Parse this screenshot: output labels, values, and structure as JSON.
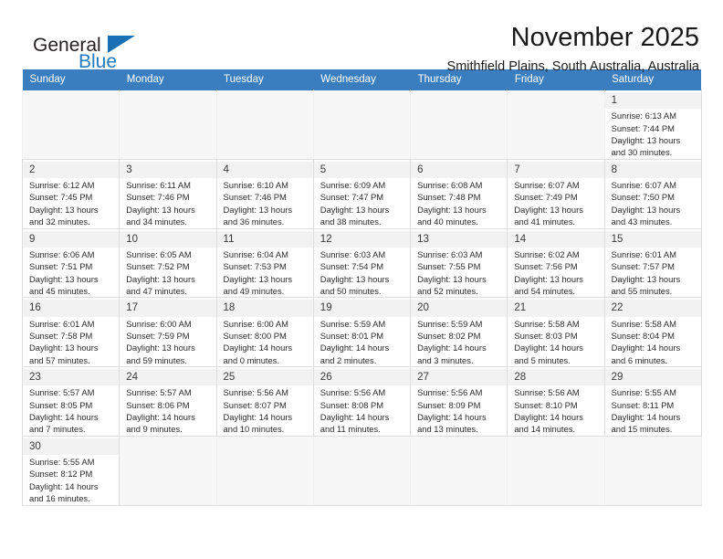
{
  "brand": {
    "name_top": "General",
    "name_bottom": "Blue",
    "accent_color": "#1a6fb5"
  },
  "header": {
    "title": "November 2025",
    "subtitle": "Smithfield Plains, South Australia, Australia"
  },
  "calendar": {
    "header_bg": "#3a7ebf",
    "weekdays": [
      "Sunday",
      "Monday",
      "Tuesday",
      "Wednesday",
      "Thursday",
      "Friday",
      "Saturday"
    ],
    "weeks": [
      [
        {
          "day": "",
          "detail": ""
        },
        {
          "day": "",
          "detail": ""
        },
        {
          "day": "",
          "detail": ""
        },
        {
          "day": "",
          "detail": ""
        },
        {
          "day": "",
          "detail": ""
        },
        {
          "day": "",
          "detail": ""
        },
        {
          "day": "1",
          "detail": "Sunrise: 6:13 AM\nSunset: 7:44 PM\nDaylight: 13 hours and 30 minutes."
        }
      ],
      [
        {
          "day": "2",
          "detail": "Sunrise: 6:12 AM\nSunset: 7:45 PM\nDaylight: 13 hours and 32 minutes."
        },
        {
          "day": "3",
          "detail": "Sunrise: 6:11 AM\nSunset: 7:46 PM\nDaylight: 13 hours and 34 minutes."
        },
        {
          "day": "4",
          "detail": "Sunrise: 6:10 AM\nSunset: 7:46 PM\nDaylight: 13 hours and 36 minutes."
        },
        {
          "day": "5",
          "detail": "Sunrise: 6:09 AM\nSunset: 7:47 PM\nDaylight: 13 hours and 38 minutes."
        },
        {
          "day": "6",
          "detail": "Sunrise: 6:08 AM\nSunset: 7:48 PM\nDaylight: 13 hours and 40 minutes."
        },
        {
          "day": "7",
          "detail": "Sunrise: 6:07 AM\nSunset: 7:49 PM\nDaylight: 13 hours and 41 minutes."
        },
        {
          "day": "8",
          "detail": "Sunrise: 6:07 AM\nSunset: 7:50 PM\nDaylight: 13 hours and 43 minutes."
        }
      ],
      [
        {
          "day": "9",
          "detail": "Sunrise: 6:06 AM\nSunset: 7:51 PM\nDaylight: 13 hours and 45 minutes."
        },
        {
          "day": "10",
          "detail": "Sunrise: 6:05 AM\nSunset: 7:52 PM\nDaylight: 13 hours and 47 minutes."
        },
        {
          "day": "11",
          "detail": "Sunrise: 6:04 AM\nSunset: 7:53 PM\nDaylight: 13 hours and 49 minutes."
        },
        {
          "day": "12",
          "detail": "Sunrise: 6:03 AM\nSunset: 7:54 PM\nDaylight: 13 hours and 50 minutes."
        },
        {
          "day": "13",
          "detail": "Sunrise: 6:03 AM\nSunset: 7:55 PM\nDaylight: 13 hours and 52 minutes."
        },
        {
          "day": "14",
          "detail": "Sunrise: 6:02 AM\nSunset: 7:56 PM\nDaylight: 13 hours and 54 minutes."
        },
        {
          "day": "15",
          "detail": "Sunrise: 6:01 AM\nSunset: 7:57 PM\nDaylight: 13 hours and 55 minutes."
        }
      ],
      [
        {
          "day": "16",
          "detail": "Sunrise: 6:01 AM\nSunset: 7:58 PM\nDaylight: 13 hours and 57 minutes."
        },
        {
          "day": "17",
          "detail": "Sunrise: 6:00 AM\nSunset: 7:59 PM\nDaylight: 13 hours and 59 minutes."
        },
        {
          "day": "18",
          "detail": "Sunrise: 6:00 AM\nSunset: 8:00 PM\nDaylight: 14 hours and 0 minutes."
        },
        {
          "day": "19",
          "detail": "Sunrise: 5:59 AM\nSunset: 8:01 PM\nDaylight: 14 hours and 2 minutes."
        },
        {
          "day": "20",
          "detail": "Sunrise: 5:59 AM\nSunset: 8:02 PM\nDaylight: 14 hours and 3 minutes."
        },
        {
          "day": "21",
          "detail": "Sunrise: 5:58 AM\nSunset: 8:03 PM\nDaylight: 14 hours and 5 minutes."
        },
        {
          "day": "22",
          "detail": "Sunrise: 5:58 AM\nSunset: 8:04 PM\nDaylight: 14 hours and 6 minutes."
        }
      ],
      [
        {
          "day": "23",
          "detail": "Sunrise: 5:57 AM\nSunset: 8:05 PM\nDaylight: 14 hours and 7 minutes."
        },
        {
          "day": "24",
          "detail": "Sunrise: 5:57 AM\nSunset: 8:06 PM\nDaylight: 14 hours and 9 minutes."
        },
        {
          "day": "25",
          "detail": "Sunrise: 5:56 AM\nSunset: 8:07 PM\nDaylight: 14 hours and 10 minutes."
        },
        {
          "day": "26",
          "detail": "Sunrise: 5:56 AM\nSunset: 8:08 PM\nDaylight: 14 hours and 11 minutes."
        },
        {
          "day": "27",
          "detail": "Sunrise: 5:56 AM\nSunset: 8:09 PM\nDaylight: 14 hours and 13 minutes."
        },
        {
          "day": "28",
          "detail": "Sunrise: 5:56 AM\nSunset: 8:10 PM\nDaylight: 14 hours and 14 minutes."
        },
        {
          "day": "29",
          "detail": "Sunrise: 5:55 AM\nSunset: 8:11 PM\nDaylight: 14 hours and 15 minutes."
        }
      ],
      [
        {
          "day": "30",
          "detail": "Sunrise: 5:55 AM\nSunset: 8:12 PM\nDaylight: 14 hours and 16 minutes."
        },
        {
          "day": "",
          "detail": ""
        },
        {
          "day": "",
          "detail": ""
        },
        {
          "day": "",
          "detail": ""
        },
        {
          "day": "",
          "detail": ""
        },
        {
          "day": "",
          "detail": ""
        },
        {
          "day": "",
          "detail": ""
        }
      ]
    ]
  }
}
